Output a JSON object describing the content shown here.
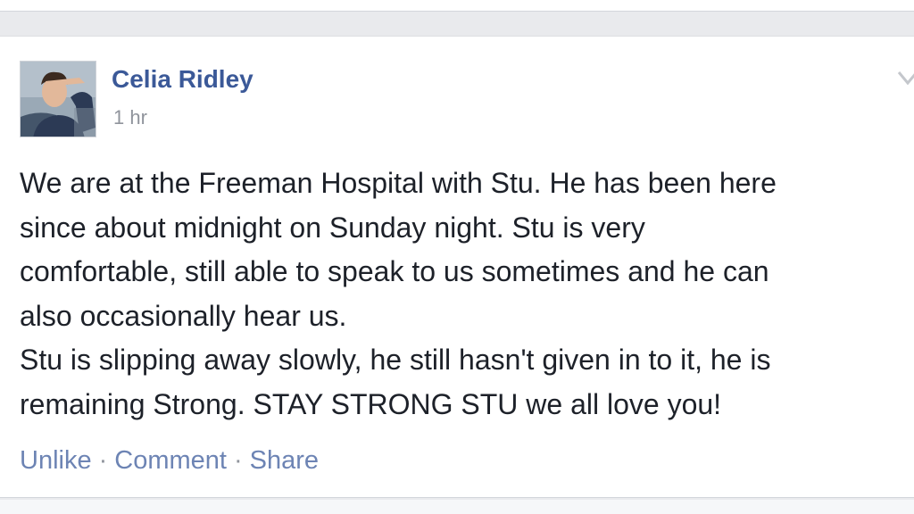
{
  "post": {
    "author_name": "Celia Ridley",
    "timestamp": "1 hr",
    "body_lines": [
      "We are at the Freeman Hospital with Stu. He has been here",
      "since about midnight on Sunday night. Stu is very",
      "comfortable, still able to speak to us sometimes and he can",
      "also occasionally hear us.",
      "Stu is slipping away slowly, he still hasn't given in to it, he is",
      "remaining Strong. STAY STRONG STU we all love you!"
    ],
    "actions": {
      "unlike_label": "Unlike",
      "comment_label": "Comment",
      "share_label": "Share",
      "separator": "·"
    },
    "menu_icon": "chevron-down-icon"
  },
  "colors": {
    "link_blue": "#3b5998",
    "action_blue": "#6d84b4",
    "meta_gray": "#90949c",
    "text_dark": "#1d2129",
    "background": "#e9eaed"
  }
}
